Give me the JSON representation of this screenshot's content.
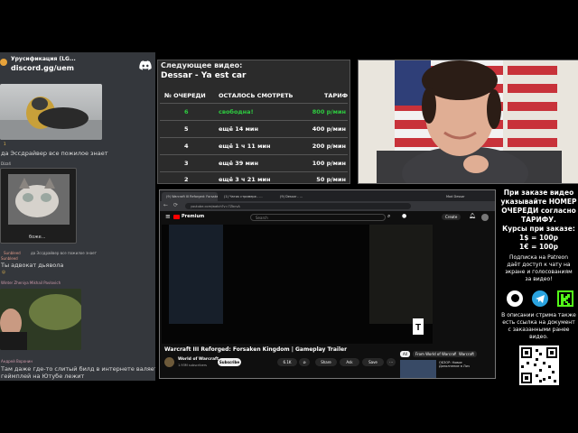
{
  "chat": {
    "server_name": "Урусификация (LG...",
    "invite": "discord.gg/uem",
    "messages": [
      {
        "author": "Ахуенный пришелец",
        "text": "да Эссдрайвер все пожилое знает",
        "reaction": "1"
      },
      {
        "author": "Dizz4",
        "text": ""
      },
      {
        "author": "Dizz4",
        "caption": "боже...",
        "text": ""
      },
      {
        "author": "Sunbleed",
        "text": "да Эссдрайвер все пожилое знает"
      },
      {
        "author": "Sunbleed",
        "text": "Ты адвокат дьявола"
      },
      {
        "author": "Winter Zheniya Mikhail Pavlovich",
        "text": ""
      },
      {
        "author": "Андрей Воронин",
        "text": "Там даже где-то слитый билд в интернете валяется и"
      },
      {
        "author": "",
        "text": "геймплей на Ютубе лежит"
      }
    ]
  },
  "queue": {
    "label": "Следующее видео:",
    "title": "Dessar - Ya est car",
    "headers": [
      "№ ОЧЕРЕДИ",
      "ОСТАЛОСЬ СМОТРЕТЬ",
      "ТАРИФ"
    ],
    "rows": [
      {
        "n": "6",
        "left": "свободна!",
        "price": "800 р/мин",
        "highlight": true
      },
      {
        "n": "5",
        "left": "ещё 14 мин",
        "price": "400 р/мин",
        "highlight": false
      },
      {
        "n": "4",
        "left": "ещё 1 ч 11 мин",
        "price": "200 р/мин",
        "highlight": false
      },
      {
        "n": "3",
        "left": "ещё 39 мин",
        "price": "100 р/мин",
        "highlight": false
      },
      {
        "n": "2",
        "left": "ещё 3 ч 21 мин",
        "price": "50 р/мин",
        "highlight": false
      }
    ],
    "colors": {
      "green": "#2ecc40",
      "text": "#ffffff"
    }
  },
  "browser": {
    "tabs": [
      "(9) Warcraft III Reforged: Forsaken K...",
      "(1) Чатик стримера - ...",
      "(9) Dessar - ...",
      "Mod Dessar"
    ],
    "url": "youtube.com/watch?v=7ZbcvA",
    "yt_logo": "Premium",
    "search_placeholder": "Search",
    "create_label": "Create",
    "video_title": "Warcraft III Reforged: Forsaken Kingdom | Gameplay Trailer",
    "channel": "World of Warcraft",
    "subs": "1.93M subscribers",
    "subscribe": "Subscribe",
    "likes": "6.1K",
    "share": "Share",
    "ask": "Ask",
    "save": "Save",
    "sidebar_chips": [
      "All",
      "From World of Warcraft",
      "Warcraft"
    ],
    "sidebar_video_title": "ОБЗОР: Новое Дополнение в Лич",
    "rating": "T"
  },
  "info": {
    "lines": [
      "При заказе видео",
      "указывайте НОМЕР",
      "ОЧЕРЕДИ согласно",
      "ТАРИФУ.",
      "Курсы при заказе:",
      "1$ = 100р",
      "1€ = 100р"
    ],
    "patreon_lines": [
      "Подписка на Patreon",
      "даёт доступ к чату на",
      "экране и голосованиям",
      "за видео!"
    ],
    "desc_lines": [
      "В описании стрима также",
      "есть ссылка на документ",
      "с заказанными ранее",
      "видео."
    ],
    "icons": [
      "patreon-icon",
      "telegram-icon",
      "kick-icon",
      "qr-code-icon"
    ]
  }
}
